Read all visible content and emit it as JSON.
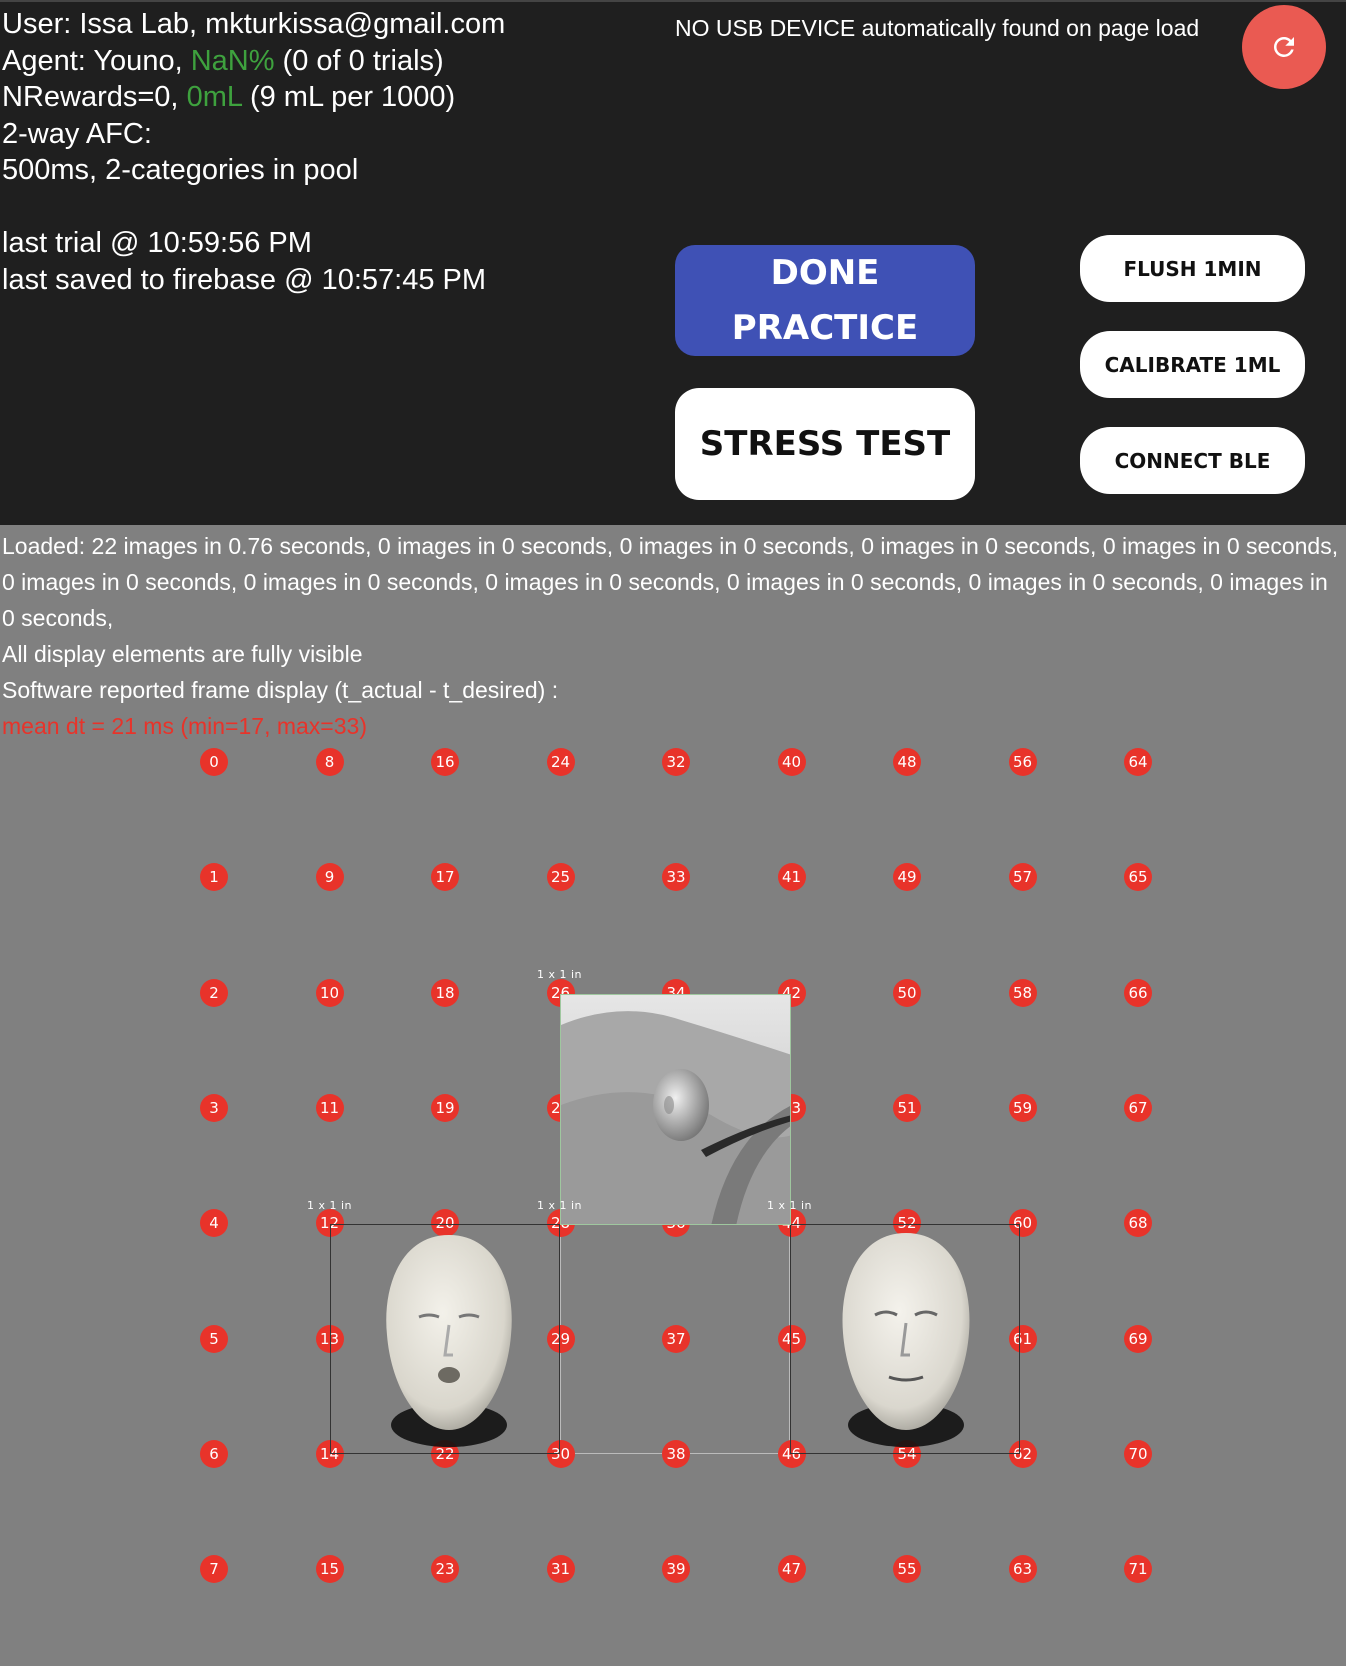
{
  "header": {
    "user_line_label": "User: ",
    "user_value": "Issa Lab, mkturkissa@gmail.com",
    "agent_label": "Agent: Youno, ",
    "agent_pct": "NaN%",
    "agent_trials": " (0 of 0 trials)",
    "rewards_label": "NRewards=0, ",
    "rewards_ml": "0mL",
    "rewards_rate": " (9 mL per 1000)",
    "task": "2-way AFC:",
    "task_detail": "500ms, 2-categories in pool",
    "last_trial": "last trial @ 10:59:56 PM",
    "last_saved": "last saved to firebase @ 10:57:45 PM",
    "usb_status": "NO USB DEVICE automatically found on page load"
  },
  "buttons": {
    "done_practice": "DONE PRACTICE",
    "stress_test": "STRESS TEST",
    "flush": "FLUSH 1MIN",
    "calibrate": "CALIBRATE 1ML",
    "connect_ble": "CONNECT BLE"
  },
  "icons": {
    "refresh": "refresh-icon"
  },
  "colors": {
    "accent_green": "#3ea13e",
    "primary_blue": "#3f51b5",
    "refresh_red": "#ea5a52",
    "alert_red": "#e8332a"
  },
  "status": {
    "loaded": "Loaded: 22 images in 0.76 seconds, 0 images in 0 seconds, 0 images in 0 seconds, 0 images in 0 seconds, 0 images in 0 seconds, 0 images in 0 seconds, 0 images in 0 seconds, 0 images in 0 seconds, 0 images in 0 seconds, 0 images in 0 seconds, 0 images in 0 seconds,",
    "visibility": "All display elements are fully visible",
    "frame_report": "Software reported frame display (t_actual - t_desired) :",
    "mean_dt": "mean dt = 21 ms (min=17, max=33)"
  },
  "grid": {
    "columns": 9,
    "rows": 8
  },
  "stimulus": {
    "box_label": "1 x 1 in"
  }
}
